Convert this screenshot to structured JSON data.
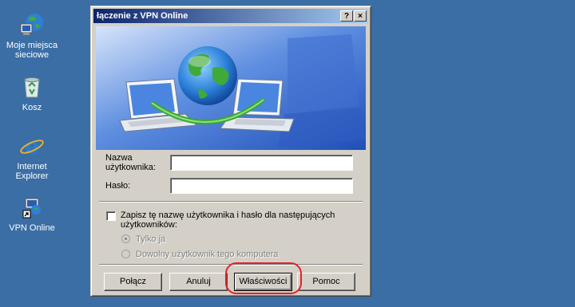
{
  "desktop": {
    "icons": [
      {
        "label_line1": "Moje miejsca",
        "label_line2": "sieciowe",
        "icon": "network-places-icon"
      },
      {
        "label_line1": "Kosz",
        "label_line2": "",
        "icon": "recycle-bin-icon"
      },
      {
        "label_line1": "Internet",
        "label_line2": "Explorer",
        "icon": "internet-explorer-icon"
      },
      {
        "label_line1": "VPN Online",
        "label_line2": "",
        "icon": "vpn-shortcut-icon"
      }
    ]
  },
  "dialog": {
    "title": "łączenie z VPN Online",
    "help_button": "?",
    "close_button": "×",
    "username_label_1": "Nazwa",
    "username_label_2": "użytkownika:",
    "username_value": "",
    "password_label": "Hasło:",
    "password_value": "",
    "save_checkbox_line1": "Zapisz tę nazwę użytkownika i hasło dla następujących",
    "save_checkbox_line2": "użytkowników:",
    "save_checked": false,
    "radio_only_me": "Tylko ja",
    "radio_anyone": "Dowolny użytkownik tego komputera",
    "radio_selected": "only_me",
    "buttons": {
      "connect": "Połącz",
      "cancel": "Anuluj",
      "properties": "Właściwości",
      "help": "Pomoc"
    }
  },
  "colors": {
    "desktop": "#3a6ea5",
    "titlebar_start": "#0a246a",
    "titlebar_end": "#a6caf0",
    "highlight_circle": "#e0242c"
  }
}
